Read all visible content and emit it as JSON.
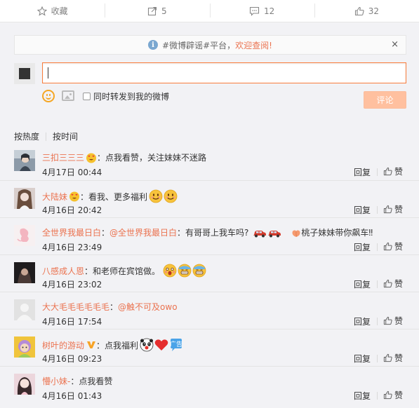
{
  "actions": {
    "favorite": {
      "label": "收藏",
      "icon": "star-icon"
    },
    "forward": {
      "label": "5",
      "icon": "share-icon"
    },
    "comment": {
      "label": "12",
      "icon": "comment-icon"
    },
    "like": {
      "label": "32",
      "icon": "thumbs-up-icon"
    }
  },
  "notice": {
    "prefix": "#微博辟谣#平台，",
    "link": "欢迎查阅!",
    "close": "×"
  },
  "composer": {
    "value": "",
    "forward_label": "同时转发到我的微博",
    "submit_label": "评论"
  },
  "sort": {
    "hot": "按热度",
    "time": "按时间"
  },
  "comments": [
    {
      "user": "三扣三三三",
      "badge": "heart-eyes-emoji",
      "text": "：点我看赞，关注妹妹不迷路",
      "date": "4月17日 00:44",
      "reply": "回复",
      "like": "赞"
    },
    {
      "user": "大陆妹",
      "badge": "heart-eyes-emoji",
      "text": "：看我、更多福利",
      "date": "4月16日 20:42",
      "reply": "回复",
      "like": "赞"
    },
    {
      "user": "全世界我最日白",
      "mention": "@全世界我最日白",
      "text": "：有哥哥上我车吗?",
      "tail": "桃子妹妹带你飙车‼",
      "date": "4月16日 23:49",
      "reply": "回复",
      "like": "赞"
    },
    {
      "user": "八感成人恩",
      "text": "：和老师在宾馆做。",
      "date": "4月16日 23:02",
      "reply": "回复",
      "like": "赞"
    },
    {
      "user": "大大毛毛毛毛毛毛",
      "mention": "@触不可及owo",
      "text": "：",
      "date": "4月16日 17:54",
      "reply": "回复",
      "like": "赞"
    },
    {
      "user": "树叶的游动",
      "badge": "vip-v-badge",
      "text": "：点我福利",
      "date": "4月16日 09:23",
      "reply": "回复",
      "like": "赞"
    },
    {
      "user": "懵小妹-",
      "text": "：点我看赞",
      "date": "4月16日 01:43",
      "reply": "回复",
      "like": "赞"
    }
  ],
  "colors": {
    "accent": "#eb7350",
    "submit": "#ffc09f",
    "panel": "#f2f2f5"
  }
}
